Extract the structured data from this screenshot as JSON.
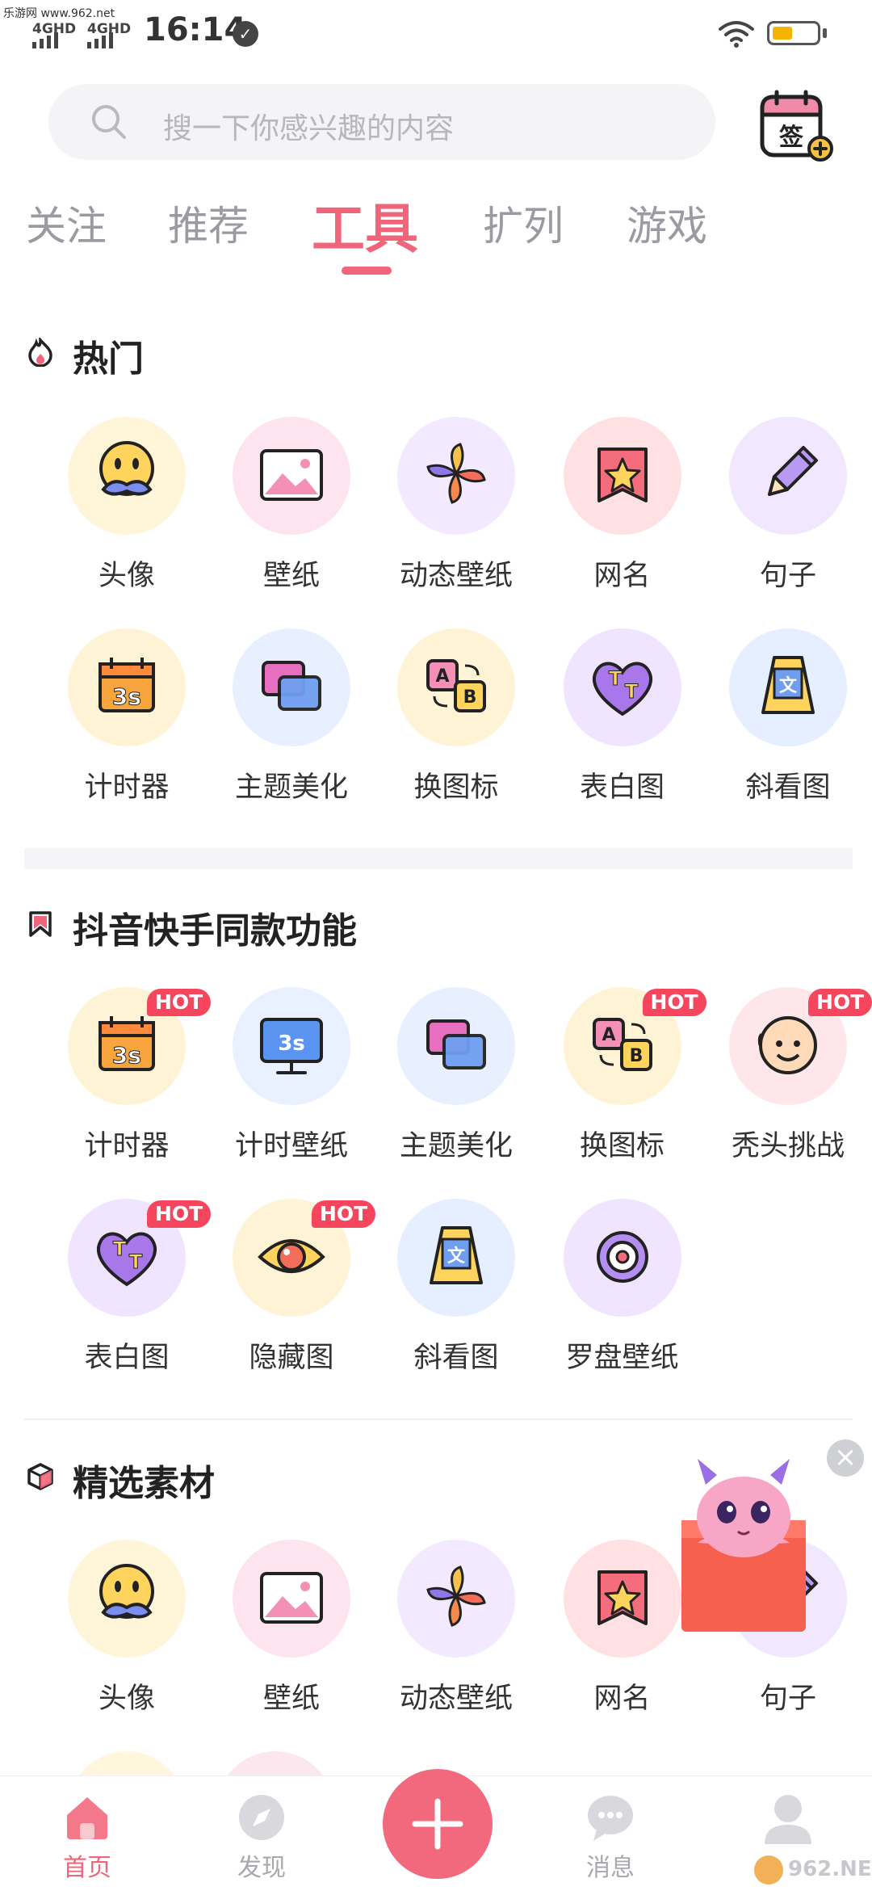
{
  "watermark": "乐游网 www.962.net",
  "status": {
    "network1": "4GHD",
    "network2": "4GHD",
    "time": "16:14",
    "battery_percent": 45
  },
  "search": {
    "placeholder": "搜一下你感兴趣的内容"
  },
  "signin": {
    "label": "签"
  },
  "tabs": [
    {
      "label": "关注"
    },
    {
      "label": "推荐"
    },
    {
      "label": "工具"
    },
    {
      "label": "扩列"
    },
    {
      "label": "游戏"
    }
  ],
  "active_tab": "工具",
  "sections": {
    "hot": {
      "title": "热门",
      "items": [
        {
          "label": "头像",
          "icon": "mustache-face-icon"
        },
        {
          "label": "壁纸",
          "icon": "picture-icon"
        },
        {
          "label": "动态壁纸",
          "icon": "pinwheel-icon"
        },
        {
          "label": "网名",
          "icon": "star-tag-icon"
        },
        {
          "label": "句子",
          "icon": "pencil-icon"
        },
        {
          "label": "计时器",
          "icon": "calendar-timer-icon"
        },
        {
          "label": "主题美化",
          "icon": "layers-icon"
        },
        {
          "label": "换图标",
          "icon": "ab-swap-icon"
        },
        {
          "label": "表白图",
          "icon": "heart-tt-icon"
        },
        {
          "label": "斜看图",
          "icon": "phone-text-icon"
        }
      ]
    },
    "douyin": {
      "title": "抖音快手同款功能",
      "hot_badge": "HOT",
      "items": [
        {
          "label": "计时器",
          "icon": "calendar-timer-icon",
          "hot": true
        },
        {
          "label": "计时壁纸",
          "icon": "monitor-timer-icon",
          "hot": false
        },
        {
          "label": "主题美化",
          "icon": "layers-icon",
          "hot": false
        },
        {
          "label": "换图标",
          "icon": "ab-swap-icon",
          "hot": true
        },
        {
          "label": "秃头挑战",
          "icon": "bald-face-icon",
          "hot": true
        },
        {
          "label": "表白图",
          "icon": "heart-tt-icon",
          "hot": true
        },
        {
          "label": "隐藏图",
          "icon": "eye-icon",
          "hot": true
        },
        {
          "label": "斜看图",
          "icon": "phone-text-icon",
          "hot": false
        },
        {
          "label": "罗盘壁纸",
          "icon": "compass-icon",
          "hot": false
        }
      ]
    },
    "materials": {
      "title": "精选素材",
      "items": [
        {
          "label": "头像",
          "icon": "mustache-face-icon"
        },
        {
          "label": "壁纸",
          "icon": "picture-icon"
        },
        {
          "label": "动态壁纸",
          "icon": "pinwheel-icon"
        },
        {
          "label": "网名",
          "icon": "star-tag-icon"
        },
        {
          "label": "句子",
          "icon": "pencil-icon"
        }
      ]
    }
  },
  "bottom_nav": [
    {
      "label": "首页",
      "icon": "home-icon",
      "active": true
    },
    {
      "label": "发现",
      "icon": "compass-nav-icon",
      "active": false
    },
    {
      "label": "",
      "icon": "plus-icon",
      "active": false
    },
    {
      "label": "消息",
      "icon": "message-icon",
      "active": false
    },
    {
      "label": "",
      "icon": "profile-icon",
      "active": false
    }
  ],
  "colors": {
    "accent": "#f0657a",
    "hot_badge": "#f5465e"
  }
}
